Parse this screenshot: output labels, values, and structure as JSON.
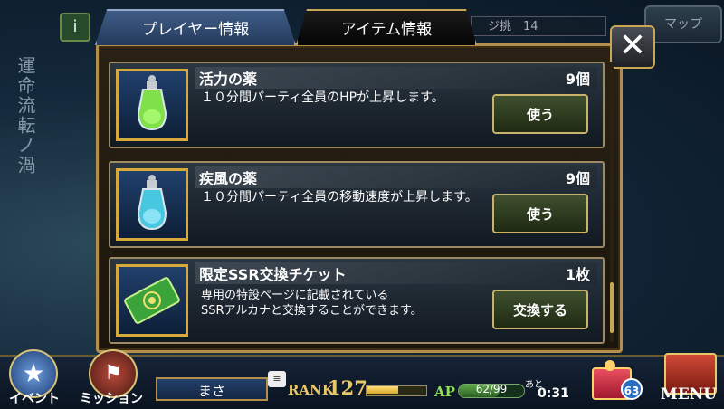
{
  "background": {
    "left_vertical_text": "運命流転ノ渦",
    "top_left_icon": "i",
    "top_right_button": "マップ",
    "top_rank_partial": "ジ挑　14"
  },
  "tabs": [
    {
      "label": "プレイヤー情報",
      "active": false
    },
    {
      "label": "アイテム情報",
      "active": true
    }
  ],
  "close_symbol": "✕",
  "items": [
    {
      "name": "活力の薬",
      "count": "9個",
      "description": "１０分間パーティ全員のHPが上昇します。",
      "action": "使う",
      "icon": "green-potion-icon"
    },
    {
      "name": "疾風の薬",
      "count": "9個",
      "description": "１０分間パーティ全員の移動速度が上昇します。",
      "action": "使う",
      "icon": "blue-potion-icon"
    },
    {
      "name": "限定SSR交換チケット",
      "count": "1枚",
      "description": "専用の特設ページに記載されている\nSSRアルカナと交換することができます。",
      "action": "交換する",
      "icon": "green-ticket-icon"
    }
  ],
  "bottom": {
    "event_label": "イベント",
    "mission_label": "ミッション",
    "player_name": "まさ",
    "chat_icon": "chat-icon",
    "rank_label": "RANK",
    "rank_value": "127",
    "rank_progress": 0.55,
    "ap_label": "AP",
    "ap_value": "62/99",
    "ap_progress": 0.626,
    "time_prefix": "あと",
    "time_value": "0:31",
    "gift_badge": "63",
    "menu_label": "MENU"
  }
}
